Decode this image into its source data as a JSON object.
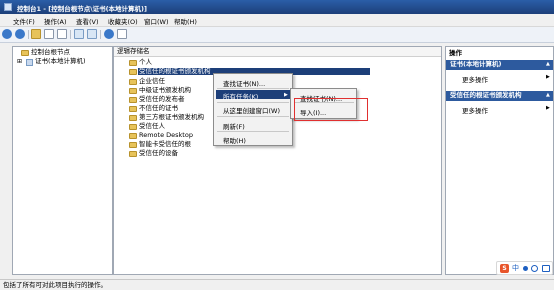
{
  "window": {
    "title": "控制台1 - [控制台根节点\\证书(本地计算机)]"
  },
  "menubar": {
    "items": [
      "文件(F)",
      "操作(A)",
      "查看(V)",
      "收藏夹(O)",
      "窗口(W)",
      "帮助(H)"
    ]
  },
  "tree": {
    "root": "控制台根节点",
    "child": "证书(本地计算机)"
  },
  "list": {
    "header": "逻辑存储名",
    "rows": [
      "个人",
      "受信任的根证书颁发机构",
      "企业信任",
      "中级证书颁发机构",
      "受信任的发布者",
      "不信任的证书",
      "第三方根证书颁发机构",
      "受信任人",
      "Remote Desktop",
      "智能卡受信任的根",
      "受信任的设备"
    ]
  },
  "context_menu": {
    "items": [
      "查找证书(N)...",
      "所有任务(K)",
      "从这里创建窗口(W)",
      "刷新(F)",
      "帮助(H)"
    ]
  },
  "submenu": {
    "items": [
      "查找证书(N)...",
      "导入(I)..."
    ]
  },
  "actions": {
    "header": "操作",
    "sections": [
      {
        "title": "证书(本地计算机)",
        "items": [
          "更多操作"
        ]
      },
      {
        "title": "受信任的根证书颁发机构",
        "items": [
          "更多操作"
        ]
      }
    ]
  },
  "statusbar": {
    "text": "包括了所有可对此项目执行的操作。"
  },
  "ime": {
    "label": "中"
  },
  "colors": {
    "selection": "#1d3f79",
    "highlight_box": "#e03030",
    "action_header": "#2d5a9e"
  }
}
